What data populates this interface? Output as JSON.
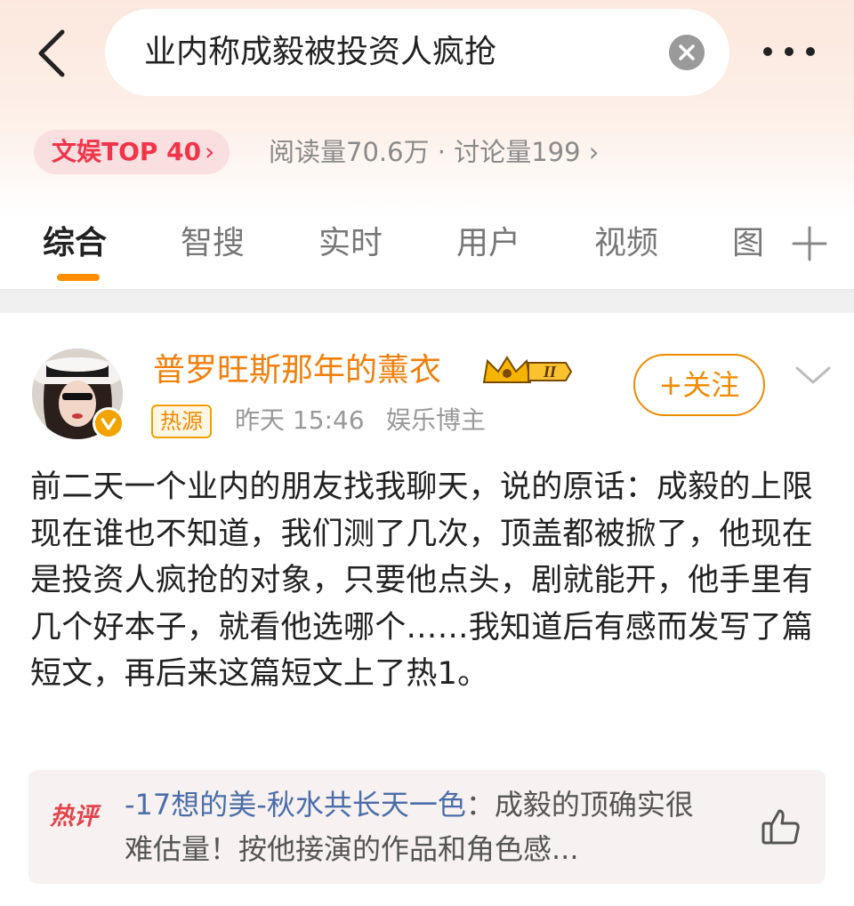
{
  "search": {
    "query": "业内称成毅被投资人疯抢"
  },
  "topic": {
    "rank_label": "文娱TOP 40",
    "rank_arrow": "›",
    "stats": "阅读量70.6万 · 讨论量199 ›"
  },
  "tabs": [
    {
      "label": "综合"
    },
    {
      "label": "智搜"
    },
    {
      "label": "实时"
    },
    {
      "label": "用户"
    },
    {
      "label": "视频"
    },
    {
      "label": "图"
    }
  ],
  "post": {
    "username": "普罗旺斯那年的薰衣",
    "tag": "热源",
    "time": "昨天 15:46",
    "role": "娱乐博主",
    "follow_label": "+关注",
    "body": "前二天一个业内的朋友找我聊天，说的原话：成毅的上限现在谁也不知道，我们测了几次，顶盖都被掀了，他现在是投资人疯抢的对象，只要他点头，剧就能开，他手里有几个好本子，就看他选哪个……我知道后有感而发写了篇短文，再后来这篇短文上了热1。",
    "hot_comment": {
      "tag": "热评",
      "author": "-17想的美-秋水共长天一色",
      "text": "：成毅的顶确实很难估量！按他接演的作品和角色感..."
    }
  },
  "colors": {
    "accent": "#ff8f00",
    "username": "#f07f0b",
    "rank": "#f0354a"
  }
}
